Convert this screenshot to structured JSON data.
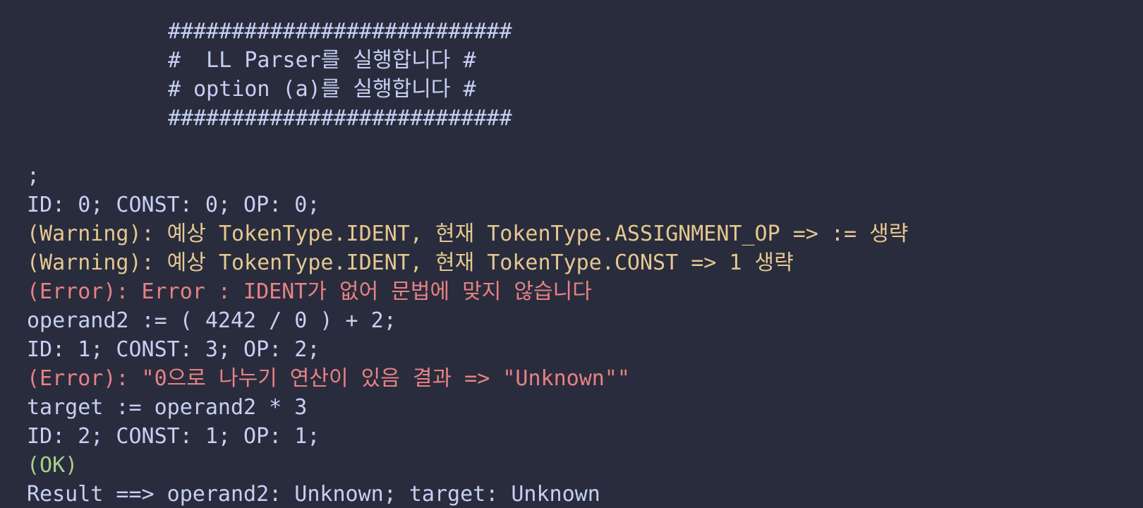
{
  "theme": {
    "background": "#292c3c",
    "text": "#c6d0f5",
    "warning": "#e5c890",
    "error": "#e78284",
    "ok": "#a6d189"
  },
  "banner": [
    "###########################",
    "#  LL Parser를 실행합니다 #",
    "# option (a)를 실행합니다 #",
    "###########################"
  ],
  "output": [
    {
      "text": ";",
      "kind": "normal"
    },
    {
      "text": "ID: 0; CONST: 0; OP: 0;",
      "kind": "normal"
    },
    {
      "text": "(Warning): 예상 TokenType.IDENT, 현재 TokenType.ASSIGNMENT_OP => := 생략",
      "kind": "warn"
    },
    {
      "text": "(Warning): 예상 TokenType.IDENT, 현재 TokenType.CONST => 1 생략",
      "kind": "warn"
    },
    {
      "text": "(Error): Error : IDENT가 없어 문법에 맞지 않습니다",
      "kind": "err"
    },
    {
      "text": "operand2 := ( 4242 / 0 ) + 2;",
      "kind": "normal"
    },
    {
      "text": "ID: 1; CONST: 3; OP: 2;",
      "kind": "normal"
    },
    {
      "text": "(Error): \"0으로 나누기 연산이 있음 결과 => \"Unknown\"\"",
      "kind": "err"
    },
    {
      "text": "target := operand2 * 3",
      "kind": "normal"
    },
    {
      "text": "ID: 2; CONST: 1; OP: 1;",
      "kind": "normal"
    },
    {
      "text": "(OK)",
      "kind": "ok"
    },
    {
      "text": "Result ==> operand2: Unknown; target: Unknown",
      "kind": "normal"
    }
  ]
}
